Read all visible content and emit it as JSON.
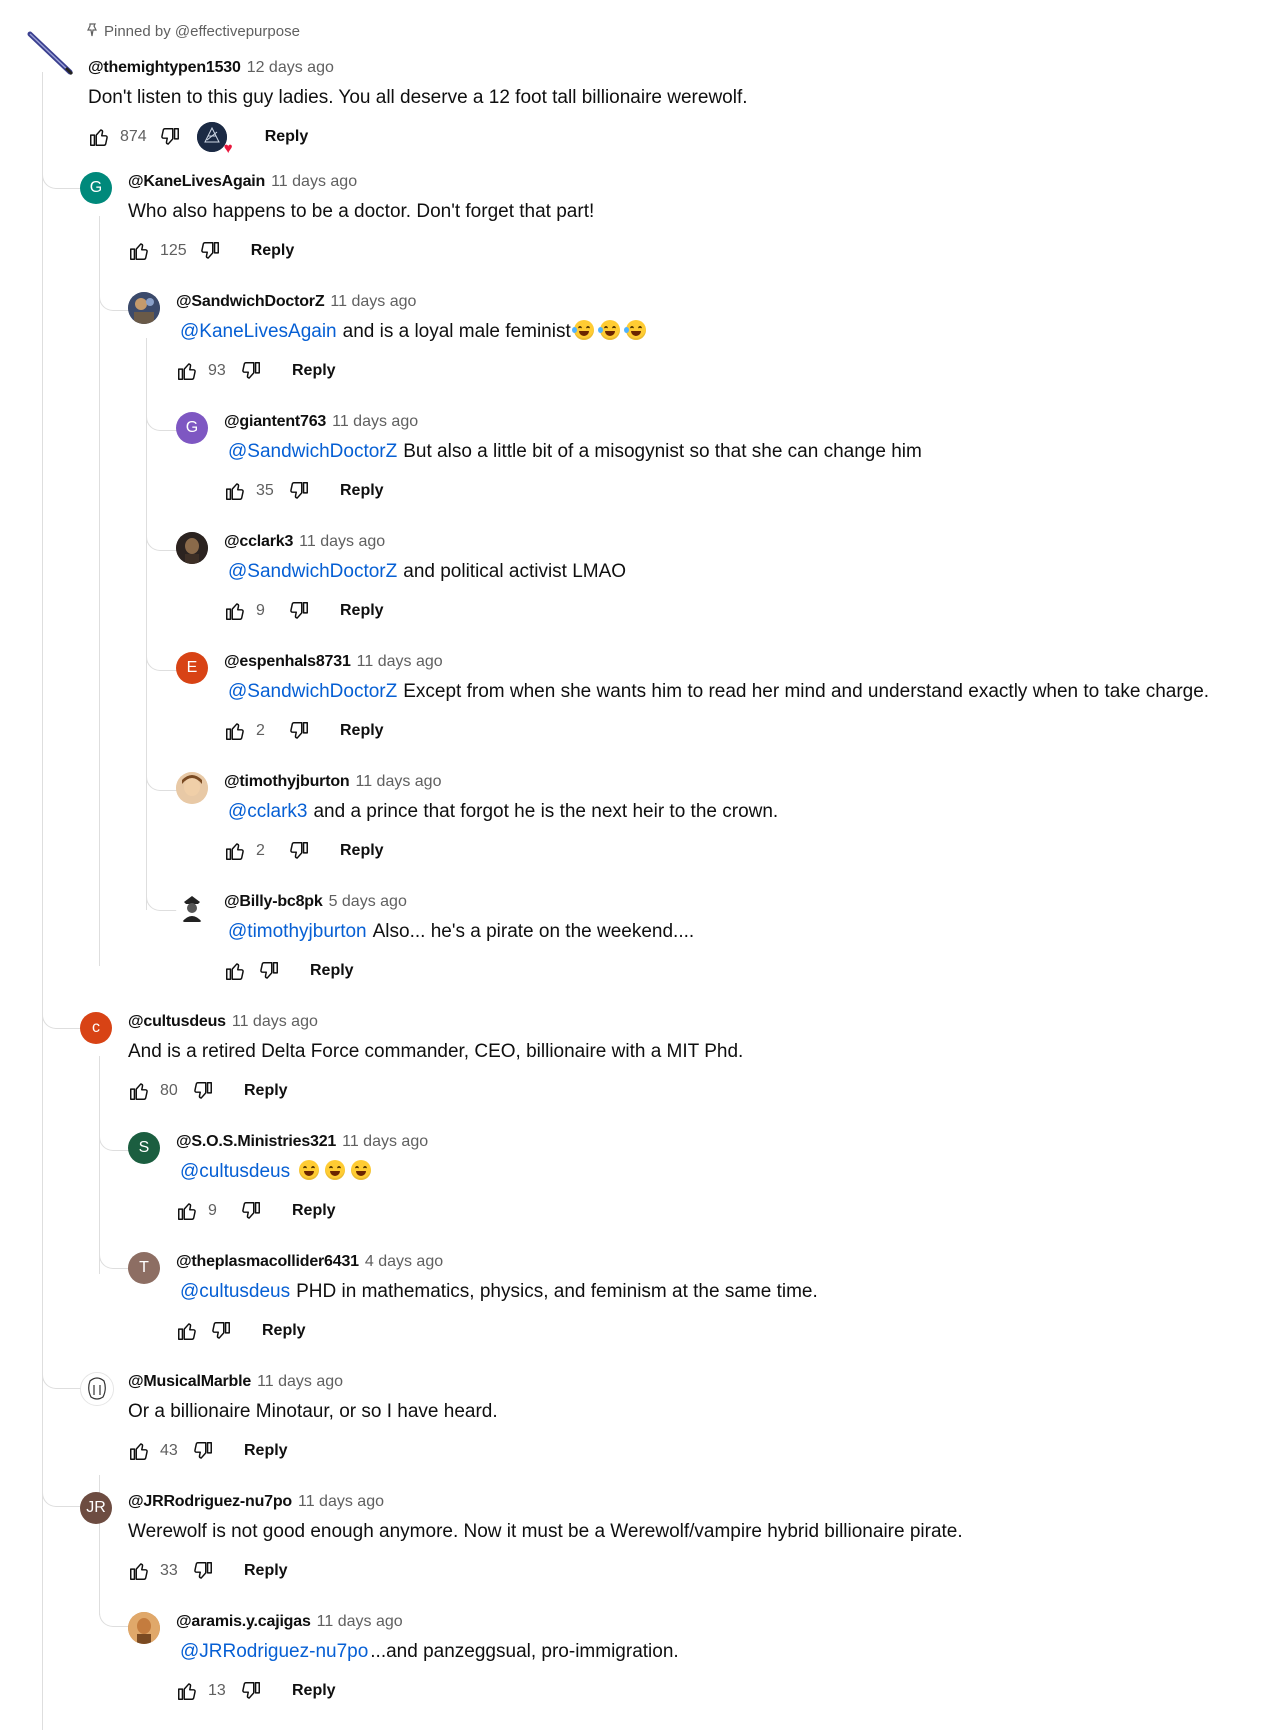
{
  "pinned": {
    "icon": "pin-icon",
    "label": "Pinned by @effectivepurpose"
  },
  "reply_label": "Reply",
  "colors": {
    "mention": "#065fd4",
    "muted": "#606060",
    "heart": "#e8173d"
  },
  "comments": [
    {
      "handle": "@themightypen1530",
      "time": "12 days ago",
      "text": "Don't listen to this guy ladies.  You all deserve a 12 foot tall billionaire werewolf.",
      "likes": "874",
      "hearted_by_creator": true,
      "avatar": {
        "icon": "pen-icon"
      }
    },
    {
      "handle": "@KaneLivesAgain",
      "time": "11 days ago",
      "text": "Who also happens to be a doctor. Don't forget that part!",
      "likes": "125",
      "avatar": {
        "letter": "G",
        "color": "#00897b"
      }
    },
    {
      "handle": "@SandwichDoctorZ",
      "time": "11 days ago",
      "mention": "@KaneLivesAgain",
      "text": "and is a loyal male feminist",
      "emoji": [
        "rofl-emoji",
        "rofl-emoji",
        "rofl-emoji"
      ],
      "likes": "93",
      "avatar": {
        "icon": "photo-avatar-icon"
      }
    },
    {
      "handle": "@giantent763",
      "time": "11 days ago",
      "mention": "@SandwichDoctorZ",
      "text": "But also a little bit of a misogynist so that she can change him",
      "likes": "35",
      "avatar": {
        "letter": "G",
        "color": "#7e57c2"
      }
    },
    {
      "handle": "@cclark3",
      "time": "11 days ago",
      "mention": "@SandwichDoctorZ",
      "text": "and political activist LMAO",
      "likes": "9",
      "avatar": {
        "icon": "photo-avatar-icon"
      }
    },
    {
      "handle": "@espenhals8731",
      "time": "11 days ago",
      "mention": "@SandwichDoctorZ",
      "text": "Except from when she wants him to read her mind and understand exactly when to take charge.",
      "likes": "2",
      "avatar": {
        "letter": "E",
        "color": "#d84315"
      }
    },
    {
      "handle": "@timothyjburton",
      "time": "11 days ago",
      "mention": "@cclark3",
      "text": "and a prince that forgot he is the next heir to the crown.",
      "likes": "2",
      "avatar": {
        "icon": "photo-avatar-icon"
      }
    },
    {
      "handle": "@Billy-bc8pk",
      "time": "5 days ago",
      "mention": "@timothyjburton",
      "text": "Also... he's a pirate on the weekend....",
      "likes": "",
      "avatar": {
        "icon": "photo-avatar-icon"
      }
    },
    {
      "handle": "@cultusdeus",
      "time": "11 days ago",
      "text": "And is a retired Delta Force commander, CEO, billionaire with a MIT Phd.",
      "likes": "80",
      "avatar": {
        "letter": "c",
        "color": "#d84315"
      }
    },
    {
      "handle": "@S.O.S.Ministries321",
      "time": "11 days ago",
      "mention": "@cultusdeus",
      "text": "",
      "emoji": [
        "joy-emoji",
        "joy-emoji",
        "joy-emoji"
      ],
      "likes": "9",
      "avatar": {
        "letter": "S",
        "color": "#1b5e40"
      }
    },
    {
      "handle": "@theplasmacollider6431",
      "time": "4 days ago",
      "mention": "@cultusdeus",
      "text": "PHD in mathematics, physics, and feminism at the same time.",
      "likes": "",
      "avatar": {
        "letter": "T",
        "color": "#8d6e63"
      }
    },
    {
      "handle": "@MusicalMarble",
      "time": "11 days ago",
      "text": "Or a billionaire Minotaur, or so I have heard.",
      "likes": "43",
      "avatar": {
        "icon": "sketch-avatar-icon"
      }
    },
    {
      "handle": "@JRRodriguez-nu7po",
      "time": "11 days ago",
      "text": "Werewolf is not good enough anymore.  Now it must be a Werewolf/vampire hybrid billionaire pirate.",
      "likes": "33",
      "avatar": {
        "letters": "JR",
        "color": "#6d4c41"
      }
    },
    {
      "handle": "@aramis.y.cajigas",
      "time": "11 days ago",
      "mention": "@JRRodriguez-nu7po",
      "text": "...and panzeggsual, pro-immigration.",
      "likes": "13",
      "avatar": {
        "icon": "photo-avatar-icon"
      }
    }
  ]
}
